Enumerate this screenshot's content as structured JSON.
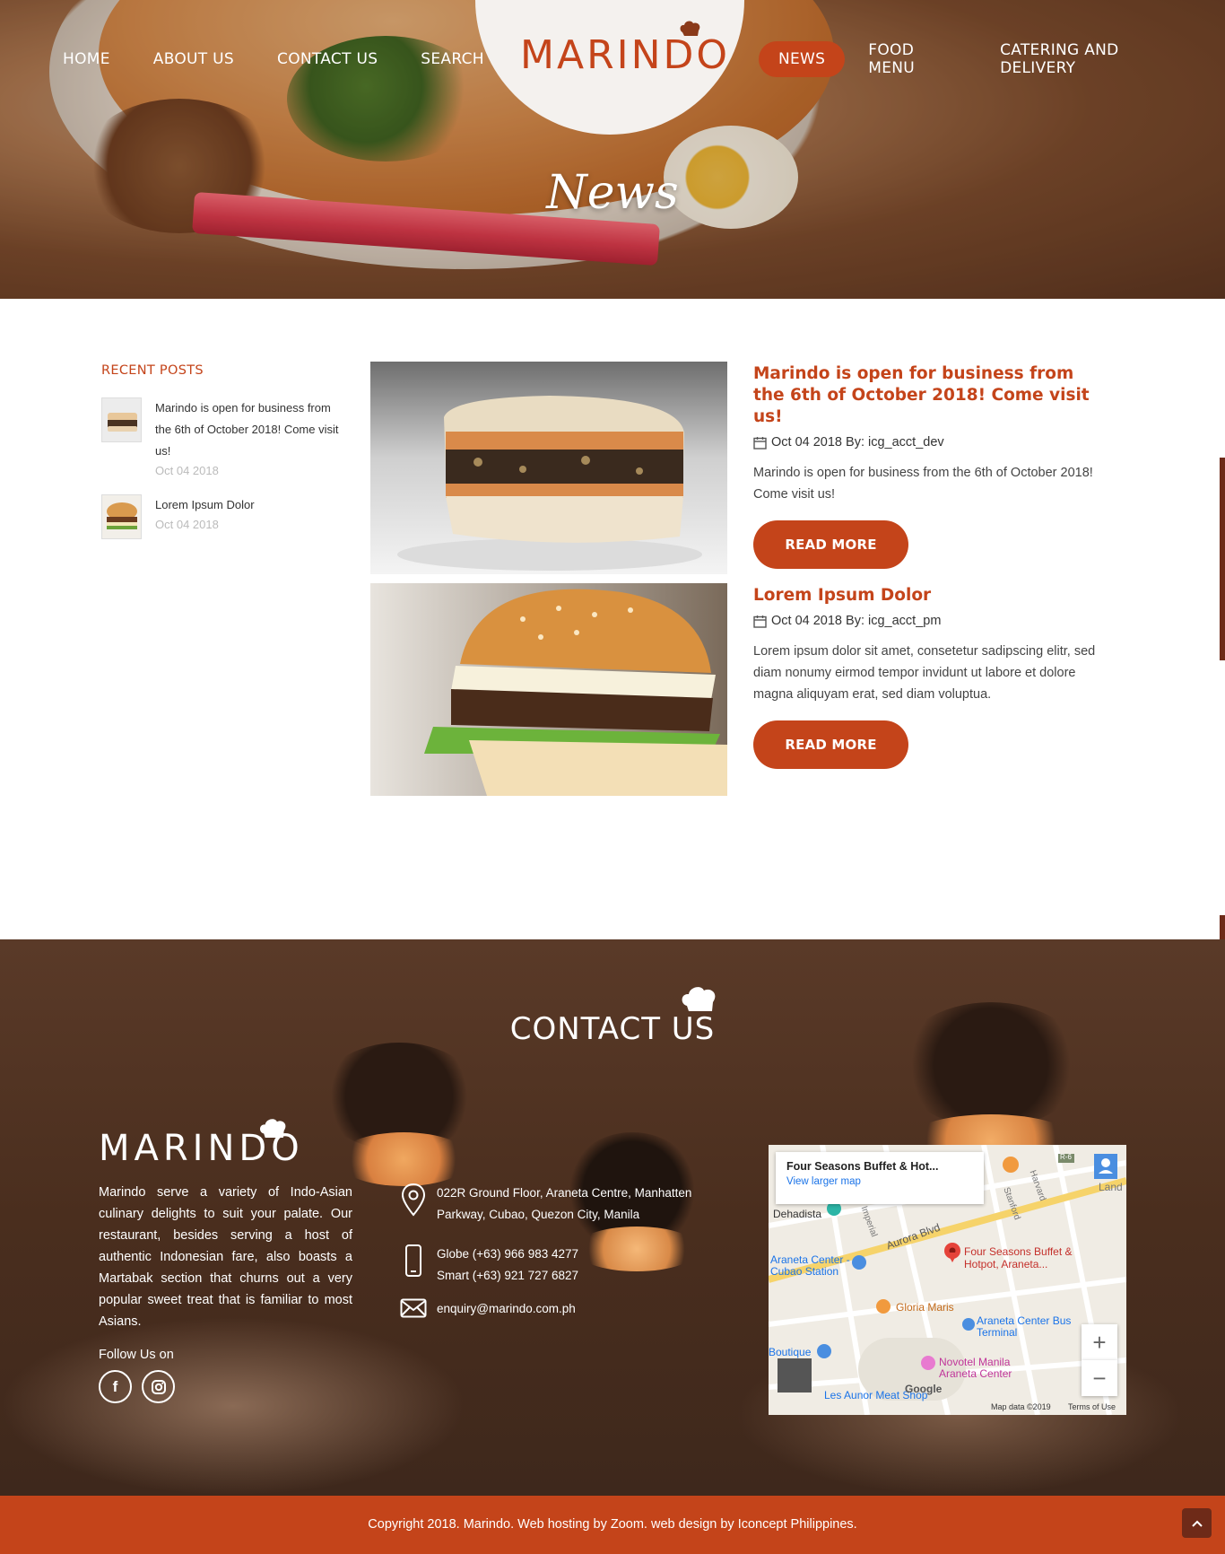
{
  "nav": {
    "left": [
      "HOME",
      "ABOUT US",
      "CONTACT US",
      "SEARCH"
    ],
    "right": [
      "NEWS",
      "FOOD MENU",
      "CATERING AND DELIVERY"
    ],
    "active": "NEWS"
  },
  "brand": {
    "logo": "MARINDO"
  },
  "hero": {
    "title": "News"
  },
  "sidebar": {
    "title": "RECENT POSTS",
    "items": [
      {
        "title": "Marindo is open for business from the 6th of October 2018! Come visit us!",
        "date": "Oct 04 2018"
      },
      {
        "title": "Lorem Ipsum Dolor",
        "date": "Oct 04 2018"
      }
    ]
  },
  "posts": [
    {
      "title": "Marindo is open for business from the 6th of October 2018! Come visit us!",
      "meta": "Oct 04 2018 By: icg_acct_dev",
      "excerpt": "Marindo is open for business from the 6th of October 2018! Come visit us!",
      "button": "READ MORE"
    },
    {
      "title": "Lorem Ipsum Dolor",
      "meta": "Oct 04 2018 By: icg_acct_pm",
      "excerpt": "Lorem ipsum dolor sit amet, consetetur sadipscing elitr, sed diam nonumy eirmod tempor invidunt ut labore et dolore magna aliquyam erat, sed diam voluptua.",
      "button": "READ MORE"
    }
  ],
  "footer": {
    "heading": "CONTACT US",
    "logo": "MARINDO",
    "about": "Marindo serve a variety of Indo-Asian culinary delights to suit your palate. Our restaurant, besides serving a host of authentic Indonesian fare, also boasts a Martabak section that churns out a very popular sweet treat that is familiar to most Asians.",
    "follow": "Follow Us on",
    "address": "022R Ground Floor, Araneta Centre, Manhatten Parkway, Cubao, Quezon City, Manila",
    "phone_globe": "Globe (+63) 966 983 4277",
    "phone_smart": "Smart (+63) 921 727 6827",
    "email": "enquiry@marindo.com.ph",
    "icons": [
      "map-pin-icon",
      "phone-icon",
      "email-icon",
      "facebook-icon",
      "instagram-icon"
    ]
  },
  "map": {
    "card_title": "Four Seasons Buffet & Hot...",
    "card_link": "View larger map",
    "labels": {
      "dehadista": "Dehadista",
      "aurora": "Aurora Blvd",
      "place": "Four Seasons Buffet & Hotpot, Araneta...",
      "araneta_center": "Araneta Center - Cubao Station",
      "gloria": "Gloria Maris",
      "bus": "Araneta Center Bus Terminal",
      "boutique": "Boutique",
      "novotel": "Novotel Manila Araneta Center",
      "les_aunor": "Les Aunor Meat Shop",
      "attribution": "Map data ©2019",
      "terms": "Terms of Use",
      "google": "Google",
      "land": "Land",
      "imperial": "Imperial",
      "stanford": "Stanford",
      "harvard": "Harvard",
      "r6": "R-6"
    }
  },
  "copyright": "Copyright 2018. Marindo. Web hosting by Zoom. web design by Iconcept Philippines.",
  "colors": {
    "accent": "#c4441a",
    "dark_accent": "#6e2a18"
  }
}
